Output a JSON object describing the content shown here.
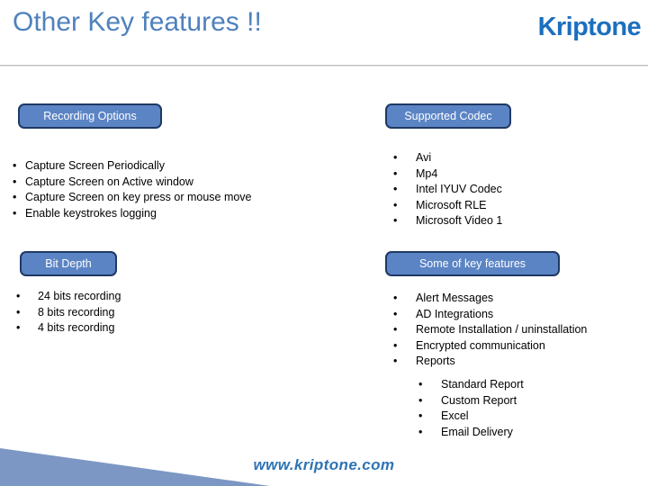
{
  "header": {
    "title": "Other Key features !!",
    "logo": "Kriptone",
    "title_color": "#4F81BD",
    "logo_color": "#1C6FBE"
  },
  "theme": {
    "pill_fill": "#5B84C4",
    "pill_border": "#1F3864",
    "pill_text": "#FFFFFF",
    "body_text": "#000000",
    "wedge_color": "#7C97C3"
  },
  "sections": {
    "recording_options": {
      "heading": "Recording Options",
      "items": [
        "Capture Screen Periodically",
        "Capture Screen on Active window",
        "Capture Screen on key press or mouse move",
        "Enable keystrokes logging"
      ]
    },
    "supported_codec": {
      "heading": "Supported Codec",
      "items": [
        "Avi",
        "Mp4",
        "Intel IYUV Codec",
        "Microsoft RLE",
        "Microsoft Video 1"
      ]
    },
    "bit_depth": {
      "heading": "Bit Depth",
      "items": [
        "24 bits recording",
        "8 bits recording",
        "4 bits recording"
      ]
    },
    "key_features": {
      "heading": "Some of key features",
      "items": [
        "Alert Messages",
        "AD Integrations",
        "Remote Installation / uninstallation",
        "Encrypted communication",
        "Reports"
      ],
      "sub_items": [
        "Standard Report",
        "Custom Report",
        "Excel",
        "Email Delivery"
      ]
    }
  },
  "footer": {
    "url": "www.kriptone.com"
  },
  "bullet_glyph": "•"
}
